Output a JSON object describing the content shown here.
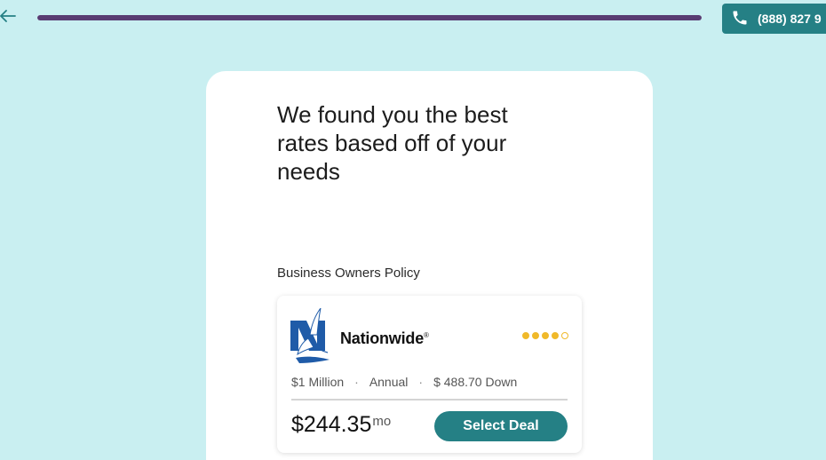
{
  "header": {
    "progress_fraction": 1.0,
    "phone_number": "(888) 827 9"
  },
  "main": {
    "headline": "We found you the best rates based off of your needs",
    "section_label": "Business Owners Policy"
  },
  "quote": {
    "carrier": "Nationwide",
    "rating": 4,
    "rating_max": 5,
    "coverage": "$1 Million",
    "term": "Annual",
    "down_payment": "$ 488.70 Down",
    "price": "$244.35",
    "price_unit": "mo",
    "cta_label": "Select Deal"
  },
  "colors": {
    "background": "#c9eff1",
    "accent": "#258085",
    "progress": "#583c72",
    "rating": "#f0b92a",
    "carrier_brand": "#1f5ba8"
  },
  "icons": {
    "back": "arrow-left-icon",
    "phone": "phone-icon",
    "carrier_logo": "nationwide-eagle-logo"
  }
}
